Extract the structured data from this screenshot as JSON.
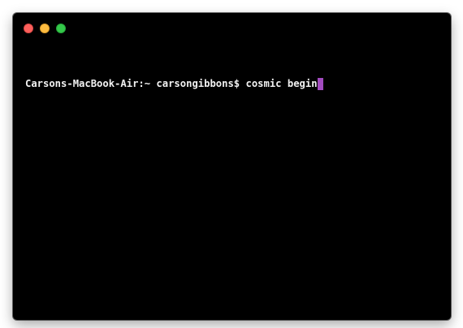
{
  "window": {
    "controls": {
      "close_color": "#fc605c",
      "minimize_color": "#fdbc40",
      "zoom_color": "#34c84a"
    },
    "background": "#000000"
  },
  "terminal": {
    "prompt": "Carsons-MacBook-Air:~ carsongibbons$",
    "command": "cosmic begin",
    "cursor_color": "#a24bbf"
  }
}
